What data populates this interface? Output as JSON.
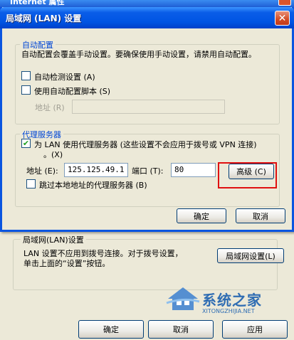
{
  "background_window": {
    "title": "Internet 属性",
    "lan_group_title": "局域网(LAN)设置",
    "lan_description": "LAN 设置不应用到拨号连接。对于拨号设置，单击上面的“设置”按钮。",
    "lan_settings_button": "局域网设置(L)",
    "ok_button": "确定",
    "cancel_button": "取消",
    "apply_button": "应用"
  },
  "dialog": {
    "title": "局域网 (LAN) 设置",
    "auto_config": {
      "group_title": "自动配置",
      "description": "自动配置会覆盖手动设置。要确保使用手动设置，请禁用自动配置。",
      "auto_detect_label": "自动检测设置 (A)",
      "auto_detect_checked": false,
      "use_script_label": "使用自动配置脚本 (S)",
      "use_script_checked": false,
      "address_label": "地址 (R)",
      "address_value": ""
    },
    "proxy": {
      "group_title": "代理服务器",
      "use_proxy_label_line1": "为 LAN 使用代理服务器 (这些设置不会应用于拨号或 VPN 连接)",
      "use_proxy_label_line2": "。(X)",
      "use_proxy_checked": true,
      "address_label": "地址 (E):",
      "address_value": "125.125.49.1",
      "port_label": "端口 (T):",
      "port_value": "80",
      "advanced_button": "高级 (C)",
      "bypass_label": "跳过本地地址的代理服务器 (B)",
      "bypass_checked": false
    },
    "ok_button": "确定",
    "cancel_button": "取消"
  },
  "watermark": {
    "text": "系统之家",
    "url": "XITONGZHIJIA.NET"
  },
  "colors": {
    "titlebar": "#0054e3",
    "group_title": "#0046d5",
    "highlight": "#e01010",
    "face": "#ece9d8"
  }
}
